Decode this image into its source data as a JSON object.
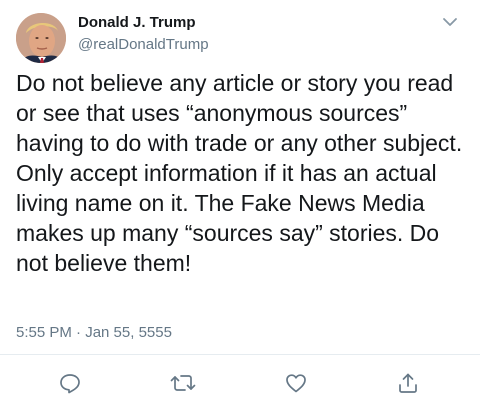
{
  "author": {
    "display_name": "Donald J. Trump",
    "handle": "@realDonaldTrump",
    "avatar_icon": "profile-photo"
  },
  "tweet": {
    "text": "Do not believe any article or story you read or see that uses “anonymous sources” having to do with trade or any other subject. Only accept information if it has an actual living name on it. The Fake News Media makes up many “sources say” stories. Do not believe them!",
    "timestamp": "5:55 PM · Jan 55, 5555"
  },
  "actions": [
    {
      "name": "reply",
      "icon": "speech-bubble-icon"
    },
    {
      "name": "retweet",
      "icon": "retweet-icon"
    },
    {
      "name": "like",
      "icon": "heart-icon"
    },
    {
      "name": "share",
      "icon": "share-icon"
    }
  ],
  "colors": {
    "text_primary": "#14171a",
    "text_secondary": "#657786",
    "icon": "#657786",
    "divider": "#e6ecf0"
  }
}
